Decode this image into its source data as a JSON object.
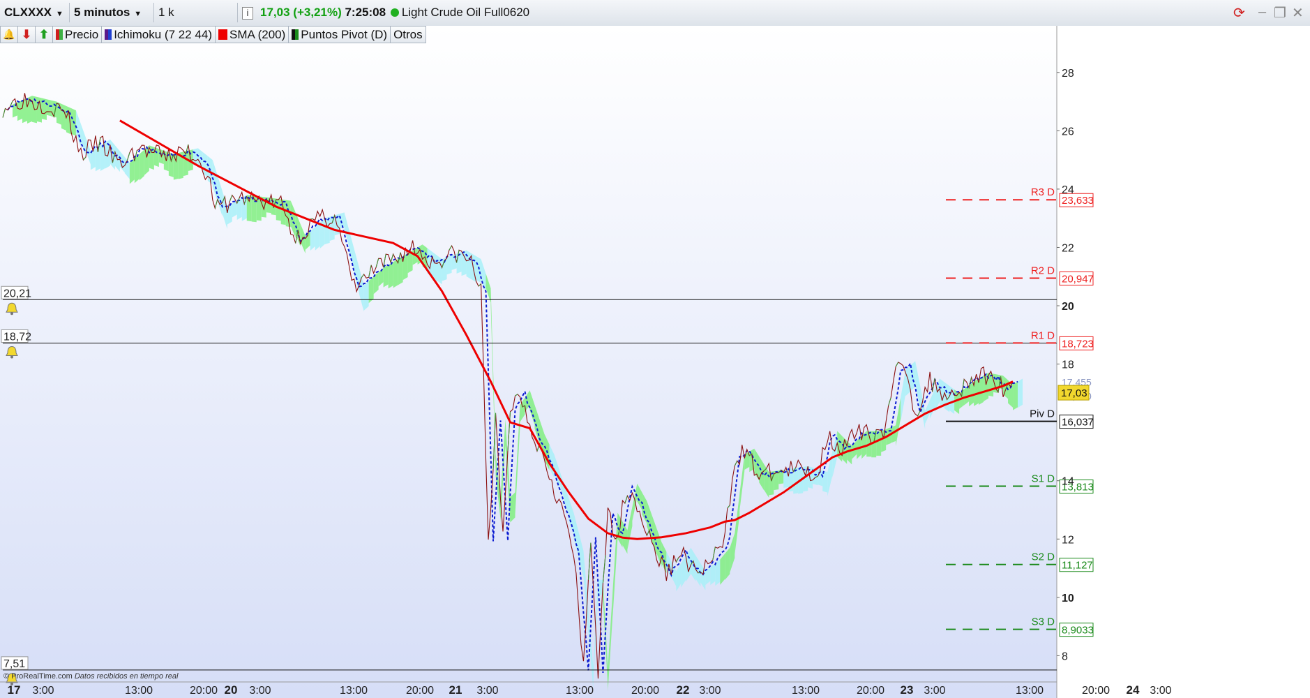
{
  "toolbar": {
    "symbol": "CLXXXX",
    "timeframe": "5 minutos",
    "units": "1 k unidades",
    "info_icon": "info-icon",
    "price": "17,03",
    "change": "(+3,21%)",
    "time": "7:25:08",
    "instrument": "Light Crude Oil Full0620",
    "status_color": "#20b020"
  },
  "indicators": [
    {
      "label": "Precio",
      "color": "#3cb043"
    },
    {
      "label": "Ichimoku (7 22 44)",
      "color": "#5a1a8a"
    },
    {
      "label": "SMA (200)",
      "color": "#ee0000"
    },
    {
      "label": "Puntos Pivot (D)",
      "color": "#1a1a1a"
    },
    {
      "label": "Otros",
      "color": ""
    }
  ],
  "footer": {
    "brand": "© ProRealTime.com",
    "note": "Datos recibidos en tiempo real"
  },
  "colors": {
    "sma": "#ee0000",
    "price": "#8b1010",
    "price_up": "#3a9a3a",
    "tenkan": "#0a1ad0",
    "cloud_bull": "#80ee80",
    "cloud_bear": "#a8f0f8",
    "pivot_red": "#ee2020",
    "pivot_green": "#1a8a1a",
    "alert_line": "#111111",
    "current_price_bg": "#f2d82e"
  },
  "chart_data": {
    "type": "line",
    "x_tick_labels": [
      {
        "label": "17",
        "day": true
      },
      {
        "label": "3:00"
      },
      {
        "label": "13:00"
      },
      {
        "label": "20:00"
      },
      {
        "label": "20",
        "day": true
      },
      {
        "label": "3:00"
      },
      {
        "label": "13:00"
      },
      {
        "label": "20:00"
      },
      {
        "label": "21",
        "day": true
      },
      {
        "label": "3:00"
      },
      {
        "label": "13:00"
      },
      {
        "label": "20:00"
      },
      {
        "label": "22",
        "day": true
      },
      {
        "label": "3:00"
      },
      {
        "label": "13:00"
      },
      {
        "label": "20:00"
      },
      {
        "label": "23",
        "day": true
      },
      {
        "label": "3:00"
      },
      {
        "label": "13:00"
      },
      {
        "label": "20:00"
      },
      {
        "label": "24",
        "day": true
      },
      {
        "label": "3:00"
      }
    ],
    "y_ticks": [
      {
        "label": "28",
        "value": 28
      },
      {
        "label": "26",
        "value": 26
      },
      {
        "label": "24",
        "value": 24
      },
      {
        "label": "22",
        "value": 22
      },
      {
        "label": "20",
        "value": 20,
        "bold": true
      },
      {
        "label": "18",
        "value": 18
      },
      {
        "label": "14",
        "value": 14
      },
      {
        "label": "12",
        "value": 12
      },
      {
        "label": "10",
        "value": 10,
        "bold": true
      },
      {
        "label": "8",
        "value": 8
      }
    ],
    "y_range": [
      7.1,
      29.0
    ],
    "series": [
      {
        "name": "Precio",
        "points": [
          [
            0,
            26.8
          ],
          [
            8,
            27.1
          ],
          [
            18,
            26.9
          ],
          [
            26,
            26.6
          ],
          [
            32,
            25.2
          ],
          [
            40,
            25.6
          ],
          [
            48,
            24.8
          ],
          [
            56,
            25.4
          ],
          [
            66,
            25.1
          ],
          [
            76,
            25.3
          ],
          [
            82,
            24.9
          ],
          [
            88,
            23.3
          ],
          [
            96,
            23.7
          ],
          [
            106,
            23.6
          ],
          [
            114,
            23.5
          ],
          [
            120,
            22.3
          ],
          [
            128,
            22.9
          ],
          [
            136,
            23.1
          ],
          [
            144,
            20.6
          ],
          [
            152,
            21.2
          ],
          [
            160,
            21.6
          ],
          [
            168,
            22.0
          ],
          [
            176,
            21.5
          ],
          [
            186,
            21.8
          ],
          [
            192,
            21.5
          ],
          [
            196,
            20.5
          ],
          [
            199,
            12.0
          ],
          [
            202,
            16.0
          ],
          [
            205,
            12.0
          ],
          [
            208,
            16.5
          ],
          [
            212,
            17.0
          ],
          [
            218,
            15.5
          ],
          [
            222,
            14.8
          ],
          [
            226,
            13.8
          ],
          [
            230,
            12.8
          ],
          [
            234,
            11.5
          ],
          [
            238,
            7.5
          ],
          [
            241,
            12.0
          ],
          [
            244,
            7.5
          ],
          [
            248,
            12.8
          ],
          [
            252,
            12.2
          ],
          [
            256,
            13.8
          ],
          [
            260,
            13.2
          ],
          [
            266,
            11.8
          ],
          [
            272,
            10.8
          ],
          [
            278,
            11.6
          ],
          [
            284,
            10.8
          ],
          [
            290,
            11.2
          ],
          [
            294,
            11.6
          ],
          [
            296,
            12.1
          ],
          [
            300,
            14.8
          ],
          [
            304,
            15.0
          ],
          [
            310,
            14.2
          ],
          [
            318,
            14.3
          ],
          [
            326,
            14.4
          ],
          [
            334,
            14.2
          ],
          [
            338,
            15.6
          ],
          [
            344,
            15.1
          ],
          [
            350,
            15.6
          ],
          [
            356,
            15.6
          ],
          [
            362,
            15.8
          ],
          [
            366,
            17.7
          ],
          [
            370,
            18.0
          ],
          [
            374,
            16.3
          ],
          [
            380,
            17.4
          ],
          [
            388,
            16.9
          ],
          [
            394,
            17.3
          ],
          [
            400,
            17.6
          ],
          [
            406,
            17.5
          ],
          [
            410,
            17.2
          ],
          [
            414,
            17.4
          ]
        ]
      },
      {
        "name": "SMA (200)",
        "points": [
          [
            48,
            26.35
          ],
          [
            80,
            24.8
          ],
          [
            112,
            23.4
          ],
          [
            136,
            22.6
          ],
          [
            152,
            22.3
          ],
          [
            160,
            22.15
          ],
          [
            170,
            21.7
          ],
          [
            180,
            20.5
          ],
          [
            190,
            19.0
          ],
          [
            200,
            17.4
          ],
          [
            208,
            16.0
          ],
          [
            216,
            15.8
          ],
          [
            224,
            14.6
          ],
          [
            232,
            13.6
          ],
          [
            240,
            12.7
          ],
          [
            248,
            12.2
          ],
          [
            254,
            12.05
          ],
          [
            260,
            12.0
          ],
          [
            270,
            12.06
          ],
          [
            280,
            12.2
          ],
          [
            290,
            12.4
          ],
          [
            296,
            12.6
          ],
          [
            300,
            12.65
          ],
          [
            306,
            12.9
          ],
          [
            312,
            13.2
          ],
          [
            320,
            13.6
          ],
          [
            330,
            14.2
          ],
          [
            340,
            14.8
          ],
          [
            346,
            15.0
          ],
          [
            354,
            15.2
          ],
          [
            362,
            15.5
          ],
          [
            370,
            15.9
          ],
          [
            378,
            16.3
          ],
          [
            386,
            16.6
          ],
          [
            394,
            16.85
          ],
          [
            402,
            17.05
          ],
          [
            410,
            17.25
          ],
          [
            414,
            17.4
          ]
        ]
      }
    ],
    "pivots": [
      {
        "label": "R3 D",
        "value_label": "23,633",
        "value": 23.633,
        "kind": "R"
      },
      {
        "label": "R2 D",
        "value_label": "20,947",
        "value": 20.947,
        "kind": "R"
      },
      {
        "label": "R1 D",
        "value_label": "18,723",
        "value": 18.723,
        "kind": "R"
      },
      {
        "label": "Piv D",
        "value_label": "16,037",
        "value": 16.037,
        "kind": "P"
      },
      {
        "label": "S1 D",
        "value_label": "13,813",
        "value": 13.813,
        "kind": "S"
      },
      {
        "label": "S2 D",
        "value_label": "11,127",
        "value": 11.127,
        "kind": "S"
      },
      {
        "label": "S3 D",
        "value_label": "8,9033",
        "value": 8.9033,
        "kind": "S"
      }
    ],
    "alert_lines": [
      {
        "label": "20,21",
        "value": 20.21
      },
      {
        "label": "18,72",
        "value": 18.72
      },
      {
        "label": "7,51",
        "value": 7.51
      }
    ],
    "current_price": {
      "label": "17,03",
      "value": 17.03
    },
    "partial_labels": [
      "17,455",
      "17,050"
    ],
    "grid": false
  }
}
